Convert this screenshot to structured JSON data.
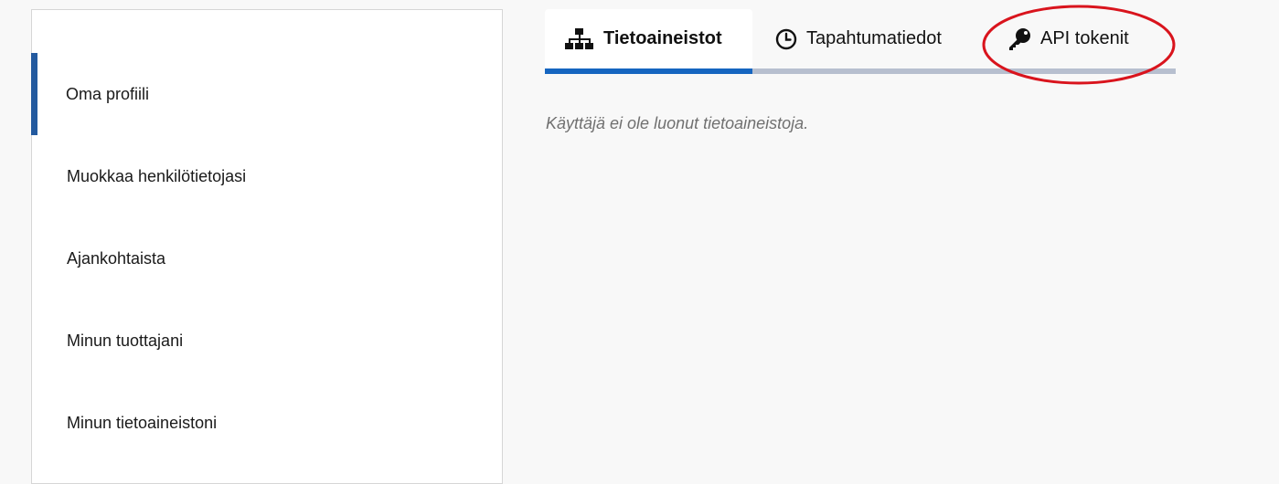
{
  "sidebar": {
    "items": [
      {
        "label": "Oma profiili",
        "active": true
      },
      {
        "label": "Muokkaa henkilötietojasi",
        "active": false
      },
      {
        "label": "Ajankohtaista",
        "active": false
      },
      {
        "label": "Minun tuottajani",
        "active": false
      },
      {
        "label": "Minun tietoaineistoni",
        "active": false
      }
    ]
  },
  "tabs": [
    {
      "label": "Tietoaineistot",
      "icon": "sitemap-icon",
      "active": true
    },
    {
      "label": "Tapahtumatiedot",
      "icon": "clock-icon",
      "active": false
    },
    {
      "label": "API tokenit",
      "icon": "key-icon",
      "active": false
    }
  ],
  "main": {
    "empty_message": "Käyttäjä ei ole luonut tietoaineistoja."
  },
  "colors": {
    "active_sidebar_bar": "#235a9f",
    "active_tab_underline": "#1565c0",
    "tab_track": "#b7bfcf",
    "annotation": "#d9141d"
  }
}
